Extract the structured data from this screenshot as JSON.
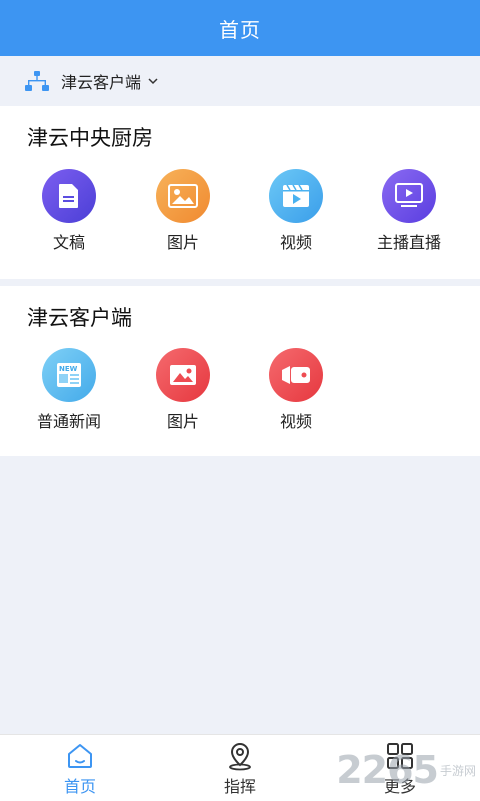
{
  "header": {
    "title": "首页"
  },
  "selector": {
    "label": "津云客户端",
    "icon": "org-tree-icon",
    "chevron": "chevron-down-icon"
  },
  "sections": [
    {
      "title": "津云中央厨房",
      "items": [
        {
          "label": "文稿",
          "icon": "document-icon",
          "color": "#5b4de0"
        },
        {
          "label": "图片",
          "icon": "image-icon",
          "color": "#f39a3c"
        },
        {
          "label": "视频",
          "icon": "video-icon",
          "color": "#4ab2f0"
        },
        {
          "label": "主播直播",
          "icon": "live-broadcast-icon",
          "color": "#6a4ee6"
        }
      ]
    },
    {
      "title": "津云客户端",
      "items": [
        {
          "label": "普通新闻",
          "icon": "news-icon",
          "color": "#58b8f0"
        },
        {
          "label": "图片",
          "icon": "image-icon",
          "color": "#ee4c52"
        },
        {
          "label": "视频",
          "icon": "video-camera-icon",
          "color": "#ee4c52"
        }
      ]
    }
  ],
  "tabbar": {
    "active_color": "#3d95f2",
    "inactive_color": "#333333",
    "tabs": [
      {
        "label": "首页",
        "icon": "home-icon",
        "active": true
      },
      {
        "label": "指挥",
        "icon": "location-pin-icon",
        "active": false
      },
      {
        "label": "更多",
        "icon": "grid-icon",
        "active": false
      }
    ]
  },
  "watermark": {
    "number": "2265",
    "text": "手游网"
  }
}
